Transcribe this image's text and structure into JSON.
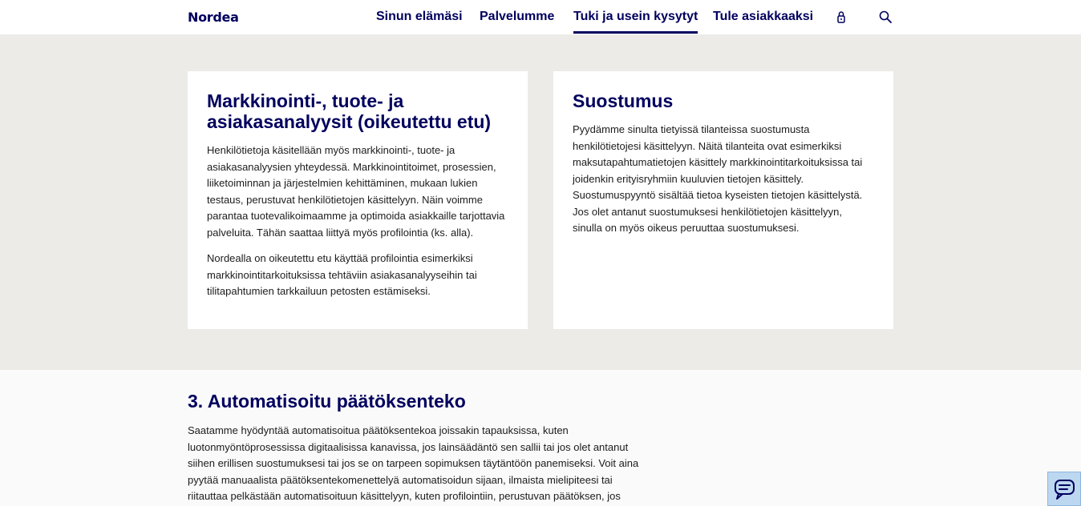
{
  "header": {
    "logo": "Nordea",
    "nav": [
      {
        "label": "Sinun elämäsi"
      },
      {
        "label": "Palvelumme"
      },
      {
        "label": "Tuki ja usein kysytyt"
      },
      {
        "label": "Tule asiakkaaksi"
      }
    ],
    "login_icon": "lock-icon",
    "search_icon": "search-icon"
  },
  "cards": [
    {
      "title": "Markkinointi-, tuote- ja asiakasanalyysit (oikeutettu etu)",
      "paragraphs": [
        "Henkilötietoja käsitellään myös markkinointi-, tuote- ja asiakasanalyysien yhteydessä. Markkinointitoimet, prosessien, liiketoiminnan ja järjestelmien kehittäminen, mukaan lukien testaus, perustuvat henkilötietojen käsittelyyn. Näin voimme parantaa tuotevalikoimaamme ja optimoida asiakkaille tarjottavia palveluita. Tähän saattaa liittyä myös profilointia (ks. alla).",
        "Nordealla on oikeutettu etu käyttää profilointia esimerkiksi markkinointitarkoituksissa tehtäviin asiakasanalyyseihin tai tilitapahtumien tarkkailuun petosten estämiseksi."
      ]
    },
    {
      "title": "Suostumus",
      "paragraphs": [
        "Pyydämme sinulta tietyissä tilanteissa suostumusta henkilötietojesi käsittelyyn. Näitä tilanteita ovat esimerkiksi maksutapahtumatietojen käsittely markkinointitarkoituksissa tai joidenkin erityisryhmiin kuuluvien tietojen käsittely. Suostumuspyyntö sisältää tietoa kyseisten tietojen käsittelystä. Jos olet antanut suostumuksesi henkilötietojen käsittelyyn, sinulla on myös oikeus peruuttaa suostumuksesi."
      ]
    }
  ],
  "section": {
    "title": "3. Automatisoitu päätöksenteko",
    "body": "Saatamme hyödyntää automatisoitua päätöksentekoa joissakin tapauksissa, kuten luotonmyöntöprosessissa digitaalisissa kanavissa, jos lainsäädäntö sen sallii tai jos olet antanut siihen erillisen suostumuksesi tai jos se on tarpeen sopimuksen täytäntöön panemiseksi. Voit aina pyytää manuaalista päätöksentekomenettelyä automatisoidun sijaan, ilmaista mielipiteesi tai riitauttaa pelkästään automatisoituun käsittelyyn, kuten profilointiin, perustuvan päätöksen, jos"
  },
  "chat": {
    "icon": "chat-icon"
  },
  "colors": {
    "brand": "#00005e",
    "band": "#edebe8",
    "chat": "#bcd7f0"
  }
}
